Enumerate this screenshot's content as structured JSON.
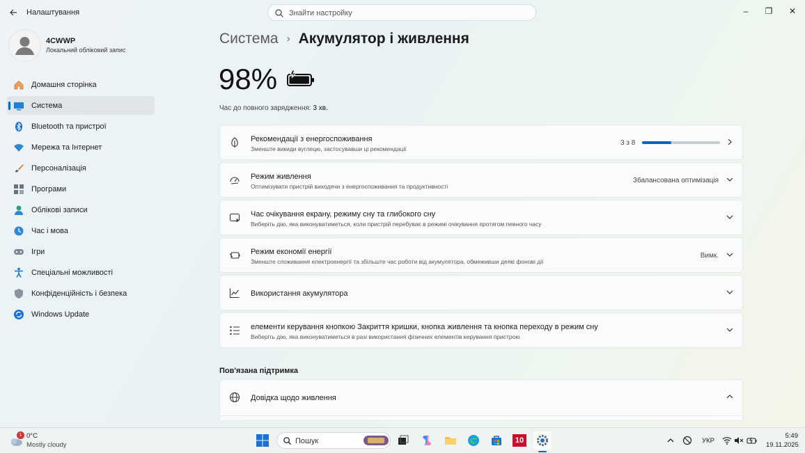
{
  "window": {
    "app_title": "Налаштування",
    "search_placeholder": "Знайти настройку",
    "minimize_glyph": "–",
    "maximize_glyph": "❐",
    "close_glyph": "✕"
  },
  "profile": {
    "name": "4CWWP",
    "account_type": "Локальний обліковий запис"
  },
  "sidebar": {
    "items": [
      {
        "label": "Домашня сторінка",
        "icon": "home-icon"
      },
      {
        "label": "Система",
        "icon": "system-icon",
        "active": true
      },
      {
        "label": "Bluetooth та пристрої",
        "icon": "bluetooth-icon"
      },
      {
        "label": "Мережа та Інтернет",
        "icon": "network-icon"
      },
      {
        "label": "Персоналізація",
        "icon": "brush-icon"
      },
      {
        "label": "Програми",
        "icon": "apps-icon"
      },
      {
        "label": "Облікові записи",
        "icon": "accounts-icon"
      },
      {
        "label": "Час і мова",
        "icon": "time-language-icon"
      },
      {
        "label": "Ігри",
        "icon": "gaming-icon"
      },
      {
        "label": "Спеціальні можливості",
        "icon": "accessibility-icon"
      },
      {
        "label": "Конфіденційність і безпека",
        "icon": "shield-icon"
      },
      {
        "label": "Windows Update",
        "icon": "windows-update-icon"
      }
    ]
  },
  "breadcrumb": {
    "parent": "Система",
    "separator": "›",
    "current": "Акумулятор і живлення"
  },
  "battery": {
    "percent": "98%",
    "charging": true,
    "level": 0.98,
    "time_label": "Час до повного зарядження:",
    "time_value": "3 хв."
  },
  "cards": {
    "energy": {
      "title": "Рекомендації з енергоспоживання",
      "subtitle": "Зменште викиди вуглецю, застосувавши ці рекомендації",
      "progress_text": "3 з 8",
      "progress_fraction": 0.375,
      "icon": "leaf-icon"
    },
    "power_mode": {
      "title": "Режим живлення",
      "subtitle": "Оптимізувати пристрій виходячи з енергоспоживання та продуктивності",
      "value": "Збалансована оптимізація",
      "icon": "power-mode-icon"
    },
    "screen_sleep": {
      "title": "Час очікування екрану, режиму сну та глибокого сну",
      "subtitle": "Виберіть дію, яка виконуватиметься, коли пристрій перебуває в режимі очікування протягом певного часу",
      "icon": "screen-sleep-icon"
    },
    "saver": {
      "title": "Режим економії енергії",
      "subtitle": "Зменште споживання електроенергії та збільште час роботи від акумулятора, обмеживши деякі фонові дії",
      "value": "Вимк.",
      "icon": "battery-saver-icon"
    },
    "usage": {
      "title": "Використання акумулятора",
      "icon": "chart-icon"
    },
    "lid": {
      "title": "елементи керування кнопкою Закриття кришки, кнопка живлення та кнопка переходу в режим сну",
      "subtitle": "Виберіть дію, яка виконуватиметься в разі використання фізичних елементів керування пристрою",
      "icon": "list-icon"
    }
  },
  "related": {
    "heading": "Пов'язана підтримка",
    "help": {
      "title": "Довідка щодо живлення",
      "icon": "globe-icon"
    }
  },
  "taskbar": {
    "weather_badge": "1",
    "weather_temp": "0°C",
    "weather_desc": "Mostly cloudy",
    "search_placeholder": "Пошук",
    "widget_badge": "10",
    "language": "УКР",
    "time": "5:49",
    "date": "19.11.2025"
  },
  "colors": {
    "accent": "#0067c0",
    "progress_track": "#c9ccd0"
  }
}
